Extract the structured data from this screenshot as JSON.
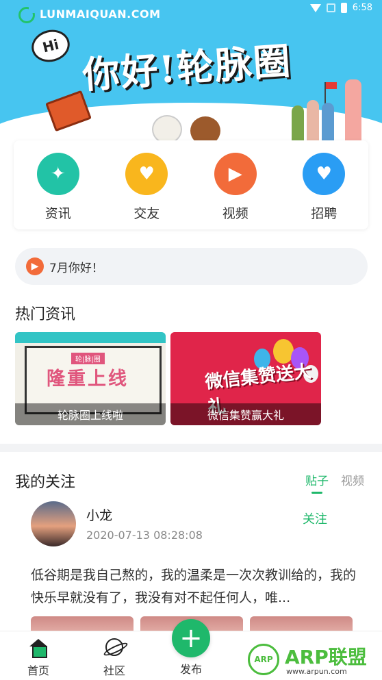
{
  "status_bar": {
    "site": "LUNMAIQUAN.COM",
    "time": "6:58"
  },
  "banner": {
    "hi": "Hi",
    "title": "你好!轮脉圈"
  },
  "quick_nav": [
    {
      "label": "资讯",
      "icon": "running-person-icon",
      "color": "#22c3a6"
    },
    {
      "label": "交友",
      "icon": "handshake-heart-icon",
      "color": "#f9b61d"
    },
    {
      "label": "视频",
      "icon": "video-camera-icon",
      "color": "#f26b3a"
    },
    {
      "label": "招聘",
      "icon": "money-heart-icon",
      "color": "#2a9df4"
    }
  ],
  "notice": {
    "icon": "megaphone-icon",
    "text": "7月你好！"
  },
  "hot_news": {
    "title": "热门资讯",
    "items": [
      {
        "tag": "轮|脉|圈",
        "image_text": "隆重上线",
        "caption": "轮脉圈上线啦"
      },
      {
        "image_text": "微信集赞送大礼",
        "caption": "微信集赞赢大礼"
      }
    ]
  },
  "following": {
    "title": "我的关注",
    "tabs": [
      {
        "label": "贴子",
        "active": true
      },
      {
        "label": "视频",
        "active": false
      }
    ],
    "post": {
      "username": " 小龙",
      "time": "2020-07-13 08:28:08",
      "follow_label": "关注",
      "text": "低谷期是我自己熬的，我的温柔是一次次教训给的，我的快乐早就没有了，我没有对不起任何人，唯..."
    }
  },
  "bottom_nav": [
    {
      "label": "首页",
      "icon": "home-icon",
      "active": true
    },
    {
      "label": "社区",
      "icon": "planet-icon",
      "active": false
    },
    {
      "label": "发布",
      "icon": "plus-icon",
      "active": false
    }
  ],
  "watermark": {
    "badge": "ARP",
    "title": "ARP联盟",
    "url": "www.arpun.com"
  }
}
